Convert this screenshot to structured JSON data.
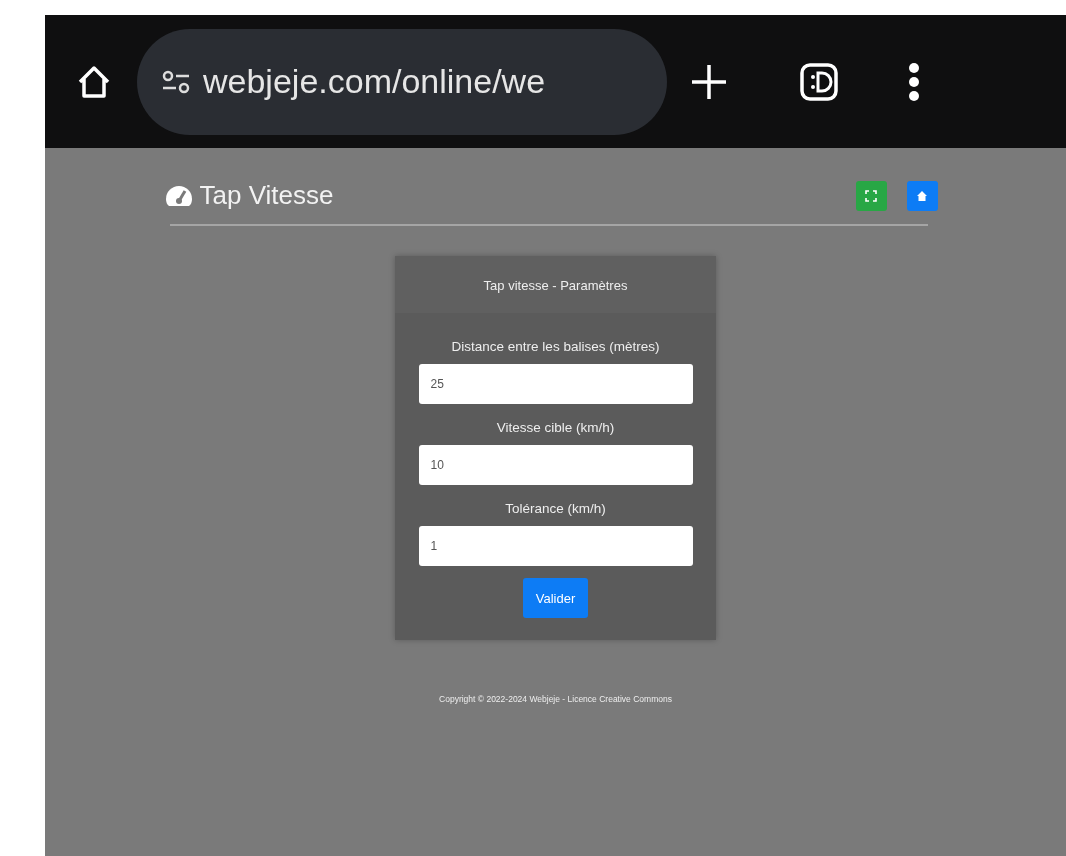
{
  "browser": {
    "url": "webjeje.com/online/we"
  },
  "header": {
    "title": "Tap Vitesse"
  },
  "card": {
    "title": "Tap vitesse - Paramètres",
    "fields": [
      {
        "label": "Distance entre les balises (mètres)",
        "value": "25"
      },
      {
        "label": "Vitesse cible (km/h)",
        "value": "10"
      },
      {
        "label": "Tolérance (km/h)",
        "value": "1"
      }
    ],
    "button": "Valider"
  },
  "footer": "Copyright © 2022-2024 Webjeje - Licence Creative Commons"
}
